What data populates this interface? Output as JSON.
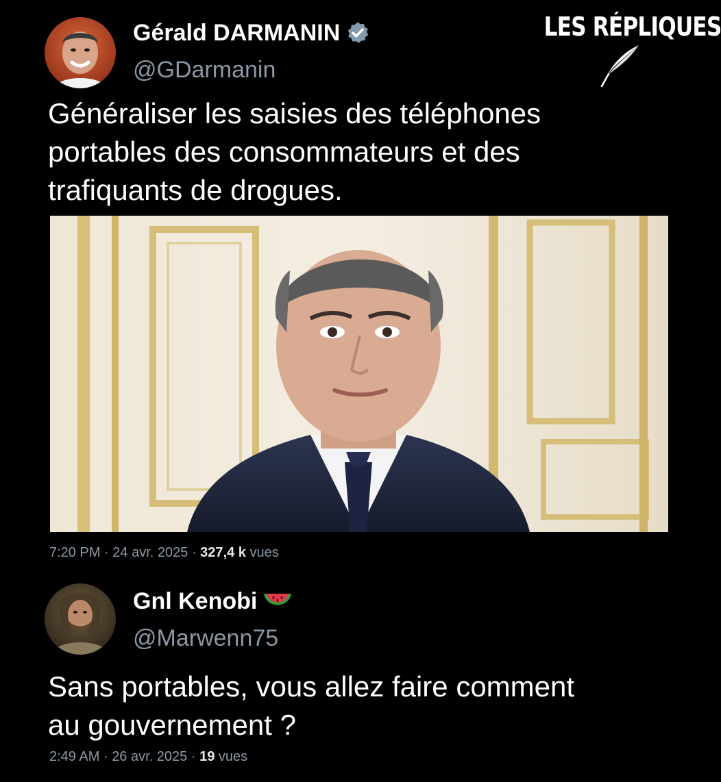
{
  "brand": {
    "title": "LES RÉPLIQUES"
  },
  "tweets": [
    {
      "author_name": "Gérald DARMANIN",
      "handle": "@GDarmanin",
      "verified": true,
      "text_lines": [
        "Généraliser les saisies des téléphones",
        "portables des consommateurs et des",
        "trafiquants de drogues."
      ],
      "time": "7:20 PM",
      "date": "24 avr. 2025",
      "views_count": "327,4 k",
      "views_label": "vues",
      "separator": "·"
    },
    {
      "author_name": "Gnl Kenobi",
      "handle": "@Marwenn75",
      "emoji": "🍉",
      "text_lines": [
        "Sans portables, vous allez faire comment",
        "au gouvernement ?"
      ],
      "time": "2:49 AM",
      "date": "26 avr. 2025",
      "views_count": "19",
      "views_label": "vues",
      "separator": "·"
    }
  ],
  "colors": {
    "background": "#000000",
    "text": "#ffffff",
    "muted": "#8b98a5",
    "verified_badge": "#829aab"
  }
}
